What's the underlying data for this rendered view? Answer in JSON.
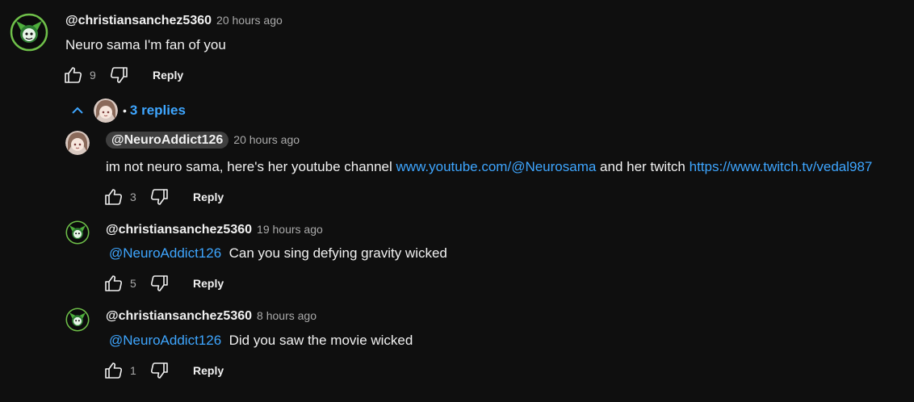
{
  "top_comment": {
    "author": "@christiansanchez5360",
    "time": "20 hours ago",
    "text": "Neuro sama I'm fan of you",
    "likes": "9",
    "reply_label": "Reply"
  },
  "replies_toggle": {
    "label": "3 replies",
    "separator": "•"
  },
  "replies": [
    {
      "author": "@NeuroAddict126",
      "time": "20 hours ago",
      "text_prefix": "im not neuro sama, here's her youtube channel ",
      "link1": "www.youtube.com/@Neurosama",
      "text_middle": " and her twitch ",
      "link2": "https://www.twitch.tv/vedal987",
      "likes": "3",
      "reply_label": "Reply"
    },
    {
      "author": "@christiansanchez5360",
      "time": "19 hours ago",
      "mention": "@NeuroAddict126",
      "text": "Can you sing defying gravity wicked",
      "likes": "5",
      "reply_label": "Reply"
    },
    {
      "author": "@christiansanchez5360",
      "time": "8 hours ago",
      "mention": "@NeuroAddict126",
      "text": "Did you saw the movie wicked",
      "likes": "1",
      "reply_label": "Reply"
    }
  ],
  "colors": {
    "background": "#0f0f0f",
    "link": "#3ea6ff",
    "meta": "#aaaaaa",
    "chip": "#3f3f3f"
  },
  "icons": {
    "like": "thumbs-up-icon",
    "dislike": "thumbs-down-icon",
    "collapse": "chevron-up-icon"
  }
}
